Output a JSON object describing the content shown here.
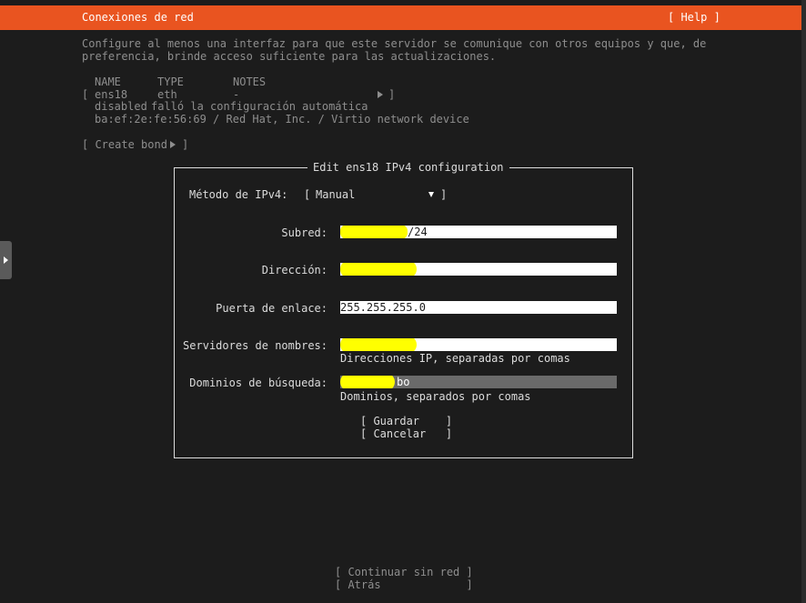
{
  "header": {
    "title": "Conexiones de red",
    "help": "[ Help ]"
  },
  "intro": {
    "line1": "Configure al menos una interfaz para que este servidor se comunique con otros equipos y que, de",
    "line2": "preferencia, brinde acceso suficiente para las actualizaciones."
  },
  "interfaces": {
    "col_name": "NAME",
    "col_type": "TYPE",
    "col_notes": "NOTES",
    "row": {
      "open_bracket": "[",
      "name": "ens18",
      "type": "eth",
      "notes": "-",
      "close_bracket": "]",
      "status": "disabled",
      "status_text": "falló la configuración automática",
      "device": "ba:ef:2e:fe:56:69 / Red Hat, Inc. / Virtio network device"
    },
    "create_bond_open": "[ Create bond",
    "create_bond_close": "]"
  },
  "dialog": {
    "title": "Edit ens18 IPv4 configuration",
    "method_label": "Método de IPv4:",
    "method_open": "[",
    "method_value": "Manual",
    "method_close": "]",
    "subnet_label": "Subred:",
    "subnet_suffix": "/24",
    "address_label": "Dirección:",
    "gateway_label": "Puerta de enlace:",
    "gateway_value": "255.255.255.0",
    "nameservers_label": "Servidores de nombres:",
    "nameservers_hint": "Direcciones IP, separadas por comas",
    "search_label": "Dominios de búsqueda:",
    "search_suffix": "bo",
    "search_hint": "Dominios, separados por comas",
    "save_button": "[ Guardar    ]",
    "cancel_button": "[ Cancelar   ]"
  },
  "footer": {
    "continue_button": "[ Continuar sin red ]",
    "back_button": "[ Atrás             ]"
  },
  "colors": {
    "accent": "#e95420",
    "background": "#1c1c1c",
    "highlight": "#ffff00"
  }
}
